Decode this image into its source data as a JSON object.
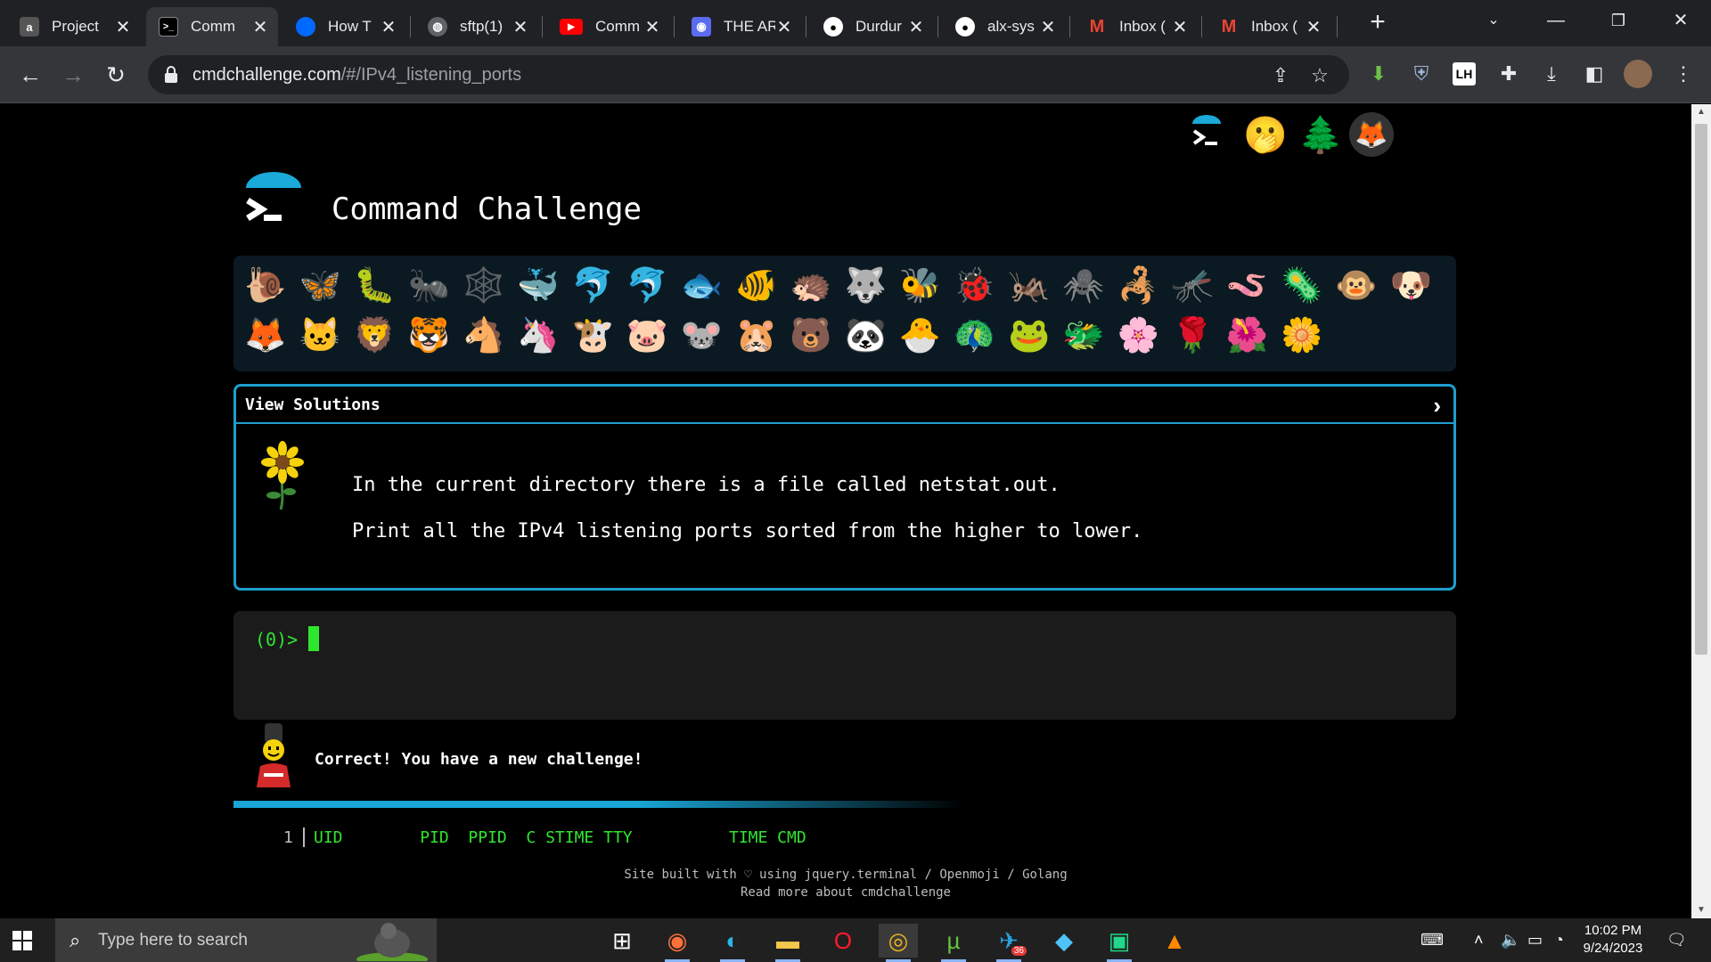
{
  "browser": {
    "tabs": [
      {
        "title": "Project",
        "favicon": "alx-icon",
        "color": "#555555"
      },
      {
        "title": "Comm",
        "favicon": "terminal-icon",
        "color": "#000000"
      },
      {
        "title": "How T",
        "favicon": "digitalocean-icon",
        "color": "#0069ff"
      },
      {
        "title": "sftp(1)",
        "favicon": "globe-icon",
        "color": "#5f6368"
      },
      {
        "title": "Comm",
        "favicon": "youtube-icon",
        "color": "#ff0000"
      },
      {
        "title": "THE AR",
        "favicon": "app-icon",
        "color": "#5b6cf0"
      },
      {
        "title": "Durdur",
        "favicon": "github-icon",
        "color": "#ffffff"
      },
      {
        "title": "alx-sys",
        "favicon": "github-icon",
        "color": "#ffffff"
      },
      {
        "title": "Inbox (",
        "favicon": "gmail-icon",
        "color": "#ea4335"
      },
      {
        "title": "Inbox (",
        "favicon": "gmail-icon",
        "color": "#ea4335"
      }
    ],
    "url_domain": "cmdchallenge.com",
    "url_path": "/#/IPv4_listening_ports"
  },
  "page": {
    "site_title": "Command Challenge",
    "badges_row1": [
      "🐌",
      "🦋",
      "🐛",
      "🐜",
      "🕸️",
      "🐳",
      "🐬",
      "🐬",
      "🐟",
      "🐠",
      "🦔",
      "🐺",
      "🐝",
      "🐞",
      "🦗",
      "🕷️",
      "🦂",
      "🦟",
      "🪱",
      "🦠",
      "🐵",
      "🐶"
    ],
    "badges_row2": [
      "🦊",
      "🐱",
      "🦁",
      "🐯",
      "🐴",
      "🦄",
      "🐮",
      "🐷",
      "🐭",
      "🐹",
      "🐻",
      "🐼",
      "🐣",
      "🦚",
      "🐸",
      "🐲",
      "🌸",
      "🌹",
      "🌺",
      "🌼"
    ],
    "view_solutions": "View Solutions",
    "challenge_line1": "In the current directory there is a file called netstat.out.",
    "challenge_line2": "Print all the IPv4 listening ports sorted from the higher to lower.",
    "prompt": "(0)>",
    "correct_msg": "Correct! You have a new challenge!",
    "output_num": "1",
    "output_header": "UID        PID  PPID  C STIME TTY          TIME CMD",
    "footer_line1": "Site built with ♡ using jquery.terminal / Openmoji / Golang",
    "footer_line2": "Read more about cmdchallenge"
  },
  "taskbar": {
    "search_placeholder": "Type here to search",
    "time": "10:02 PM",
    "date": "9/24/2023",
    "telegram_badge": "36"
  }
}
